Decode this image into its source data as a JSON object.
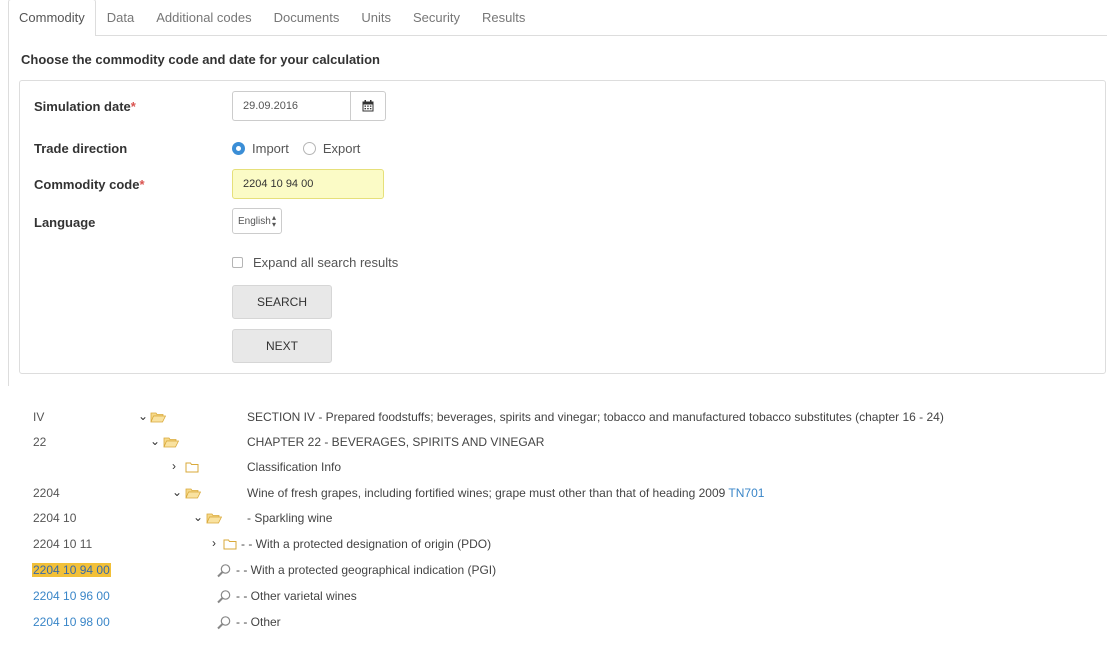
{
  "tabs": [
    "Commodity",
    "Data",
    "Additional codes",
    "Documents",
    "Units",
    "Security",
    "Results"
  ],
  "page": {
    "title": "Choose the commodity code and date for your calculation"
  },
  "form": {
    "simulation_date_label": "Simulation date",
    "simulation_date_value": "29.09.2016",
    "required_mark": "*",
    "trade_direction_label": "Trade direction",
    "import_label": "Import",
    "export_label": "Export",
    "selected_direction": "Import",
    "commodity_code_label": "Commodity code",
    "commodity_code_value": "2204 10 94 00",
    "language_label": "Language",
    "language_value": "English",
    "expand_label": "Expand all search results",
    "expand_checked": false,
    "search_button": "SEARCH",
    "next_button": "NEXT"
  },
  "colors": {
    "accent": "#3b8ed6",
    "highlight": "#f2c038",
    "link": "#3a86c8",
    "input_highlight": "#fbfbc6"
  },
  "tree": [
    {
      "code": "IV",
      "toggle": "expanded",
      "icon": "folder-open-icon",
      "desc": "SECTION IV - Prepared foodstuffs; beverages, spirits and vinegar; tobacco and manufactured tobacco substitutes (chapter 16 - 24)"
    },
    {
      "code": "22",
      "toggle": "expanded",
      "icon": "folder-open-icon",
      "desc": "CHAPTER 22 - BEVERAGES, SPIRITS AND VINEGAR"
    },
    {
      "code": "",
      "toggle": "collapsed",
      "icon": "folder-icon",
      "desc": "Classification Info"
    },
    {
      "code": "2204",
      "toggle": "expanded",
      "icon": "folder-open-icon",
      "desc": "Wine of fresh grapes, including fortified wines; grape must other than that of heading 2009",
      "note": "TN701"
    },
    {
      "code": "2204 10",
      "toggle": "expanded",
      "icon": "folder-open-icon",
      "desc": "- Sparkling wine"
    },
    {
      "code": "2204 10 11",
      "toggle": "collapsed",
      "icon": "folder-icon",
      "desc": "- - With a protected designation of origin (PDO)"
    },
    {
      "code": "2204 10 94 00",
      "icon": "magnifier-icon",
      "desc": "- - With a protected geographical indication (PGI)",
      "selected": true
    },
    {
      "code": "2204 10 96 00",
      "icon": "magnifier-icon",
      "desc": "- - Other varietal wines"
    },
    {
      "code": "2204 10 98 00",
      "icon": "magnifier-icon",
      "desc": "- - Other"
    }
  ]
}
